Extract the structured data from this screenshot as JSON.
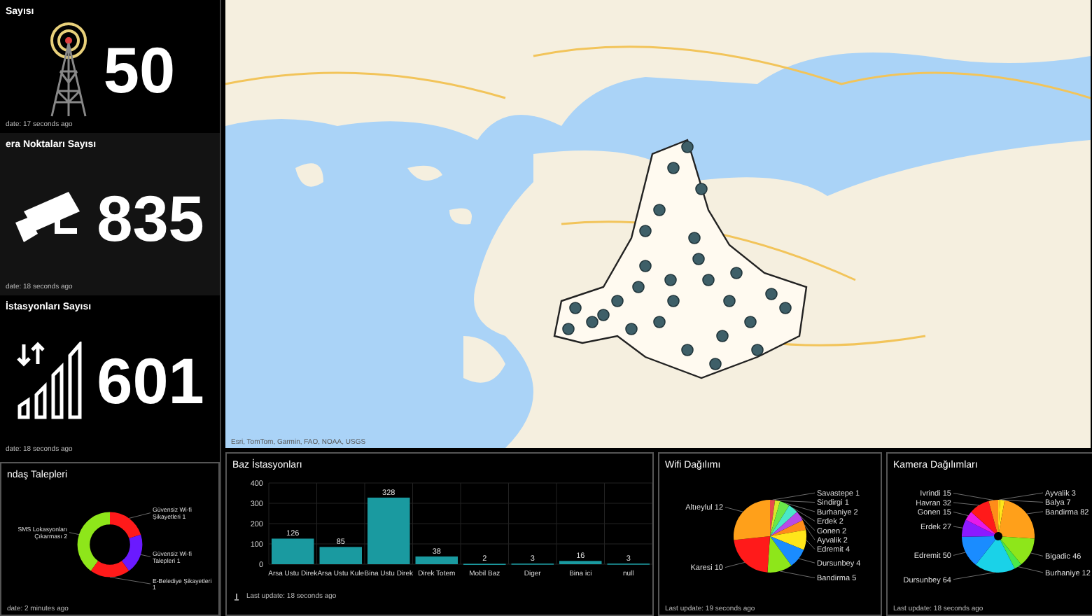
{
  "counters": [
    {
      "title": "Sayısı",
      "value": "50",
      "kind": "tower",
      "updated": "date: 17 seconds ago"
    },
    {
      "title": "era Noktaları Sayısı",
      "value": "835",
      "kind": "camera",
      "updated": "date: 18 seconds ago"
    },
    {
      "title": "İstasyonları Sayısı",
      "value": "601",
      "kind": "signal",
      "updated": "date: 18 seconds ago"
    }
  ],
  "requests": {
    "title": "ndaş Talepleri",
    "updated": "date: 2 minutes ago",
    "chart_data": {
      "type": "donut",
      "categories": [
        "Güvensiz Wi-fi Şikayetleri 1",
        "Güvensiz Wi-fi Talepleri 1",
        "E-Belediye Şikayetleri 1",
        "SMS Lokasyonları Çıkarması 2"
      ],
      "values": [
        1,
        1,
        1,
        2
      ],
      "colors": [
        "#ff1a1a",
        "#6a1aff",
        "#ff1a1a",
        "#8ee61a"
      ]
    }
  },
  "map": {
    "attribution": "Esri, TomTom, Garmin, FAO, NOAA, USGS"
  },
  "base_stations": {
    "title": "Baz İstasyonları",
    "updated": "Last update: 18 seconds ago",
    "chart_data": {
      "type": "bar",
      "categories": [
        "Arsa Ustu Direk",
        "Arsa Ustu Kule",
        "Bina Ustu Direk",
        "Direk Totem",
        "Mobil Baz",
        "Diger",
        "Bina ici",
        "null"
      ],
      "values": [
        126,
        85,
        328,
        38,
        2,
        3,
        16,
        3
      ],
      "ylim": [
        0,
        400
      ],
      "yticks": [
        0,
        100,
        200,
        300,
        400
      ],
      "data_labels": true,
      "grid": true
    }
  },
  "wifi": {
    "title": "Wifi Dağılımı",
    "updated": "Last update: 19 seconds ago",
    "chart_data": {
      "type": "pie",
      "categories": [
        "Savastepe 1",
        "Sindirgi 1",
        "Burhaniye 2",
        "Erdek 2",
        "Gonen 2",
        "Ayvalik 2",
        "Edremit 4",
        "Dursunbey 4",
        "Bandirma 5",
        "Karesi 10",
        "Altıeylul 12"
      ],
      "values": [
        1,
        1,
        2,
        2,
        2,
        2,
        4,
        4,
        5,
        10,
        12
      ],
      "colors": [
        "#e84a4a",
        "#d6e82a",
        "#6ae84a",
        "#4ae8c8",
        "#b84ae8",
        "#ff8c1a",
        "#ffe61a",
        "#1a8cff",
        "#8ee61a",
        "#ff1a1a",
        "#ffa01a"
      ]
    }
  },
  "cameras": {
    "title": "Kamera Dağılımları",
    "updated": "Last update: 18 seconds ago",
    "chart_data": {
      "type": "pie",
      "categories": [
        "Ayvalik 3",
        "Balya 7",
        "Bandirma 82",
        "Bigadic 46",
        "Burhaniye 12",
        "Dursunbey 64",
        "Edremit 50",
        "Erdek 27",
        "Gonen 15",
        "Havran 32",
        "Ivrindi 15"
      ],
      "values": [
        3,
        7,
        82,
        46,
        12,
        64,
        50,
        27,
        15,
        32,
        15
      ],
      "colors": [
        "#ffd21a",
        "#ffe61a",
        "#ffa01a",
        "#8ee61a",
        "#4ae84a",
        "#1ad2e8",
        "#1a8cff",
        "#8c1aff",
        "#e81ae8",
        "#ff1a1a",
        "#ff8c1a"
      ]
    }
  }
}
